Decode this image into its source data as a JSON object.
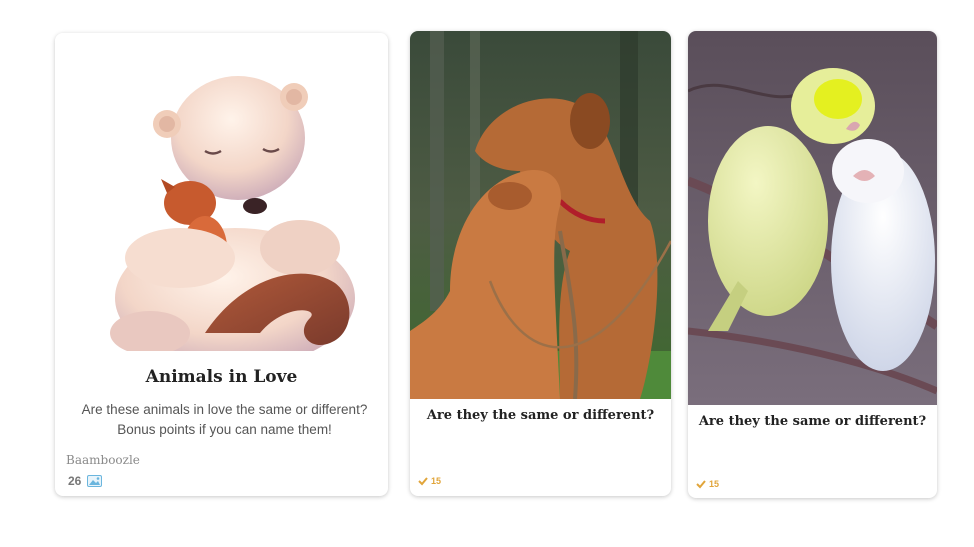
{
  "cards": [
    {
      "title": "Animals in Love",
      "description_lines": [
        "Are these animals in love the same or different?",
        "Bonus points if you can name them!"
      ],
      "creator": "Baamboozle",
      "count": "26",
      "image": "bear-hugging-fox-illustration",
      "icon": "photo-icon"
    },
    {
      "title": "Are they the same or different?",
      "plays": "15",
      "image": "two-dogs-nuzzling-photo",
      "icon": "checkmark-icon"
    },
    {
      "title": "Are they the same or different?",
      "plays": "15",
      "image": "two-parakeets-on-branch-photo",
      "icon": "checkmark-icon"
    }
  ],
  "colors": {
    "accent_gold": "#e1a53a",
    "title_text": "#222222",
    "body_text": "#555555"
  }
}
